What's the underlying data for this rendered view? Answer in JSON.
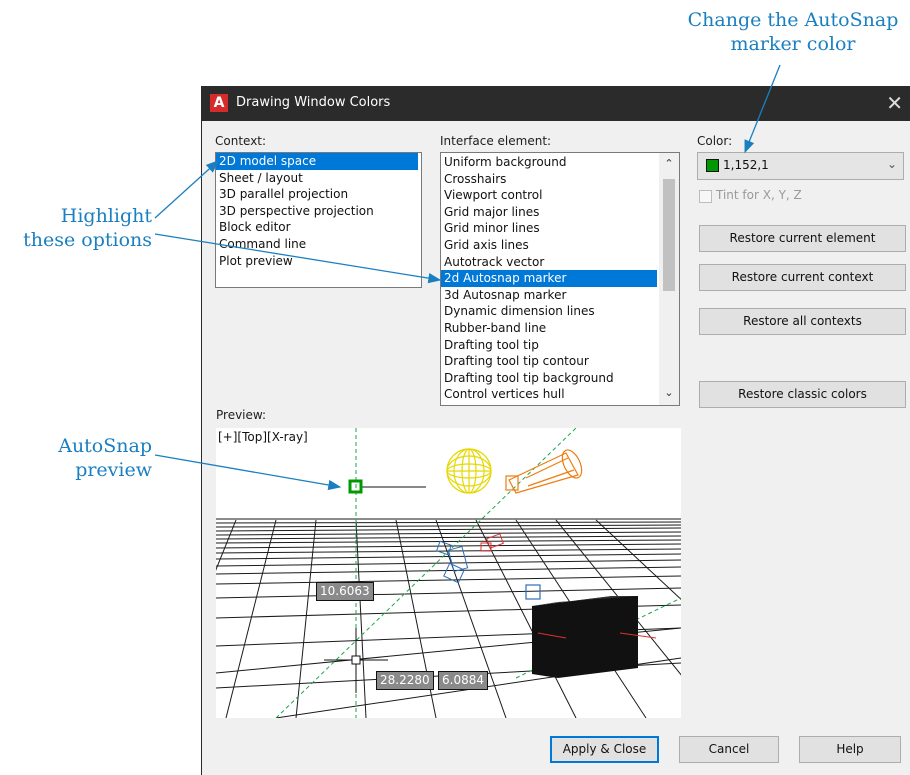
{
  "callouts": {
    "autosnap_color": [
      "Change the AutoSnap",
      "marker color"
    ],
    "highlight": [
      "Highlight",
      "these options"
    ],
    "preview": [
      "AutoSnap",
      "preview"
    ]
  },
  "dialog": {
    "title": "Drawing Window Colors",
    "app_icon": "A",
    "close_icon": "close-icon",
    "context_label": "Context:",
    "context_items": [
      "2D model space",
      "Sheet / layout",
      "3D parallel projection",
      "3D perspective projection",
      "Block editor",
      "Command line",
      "Plot preview"
    ],
    "context_selected": 0,
    "element_label": "Interface element:",
    "element_items": [
      "Uniform background",
      "Crosshairs",
      "Viewport control",
      "Grid major lines",
      "Grid minor lines",
      "Grid axis lines",
      "Autotrack vector",
      "2d Autosnap marker",
      "3d Autosnap marker",
      "Dynamic dimension lines",
      "Rubber-band line",
      "Drafting tool tip",
      "Drafting tool tip contour",
      "Drafting tool tip background",
      "Control vertices hull"
    ],
    "element_selected": 7,
    "color_label": "Color:",
    "color_value": "1,152,1",
    "color_swatch": "#019801",
    "tint_label": "Tint for X, Y, Z",
    "restore_element": "Restore current element",
    "restore_context": "Restore current context",
    "restore_all": "Restore all contexts",
    "restore_classic": "Restore classic colors",
    "preview_label": "Preview:",
    "viewport_label": "[+][Top][X-ray]",
    "dim_1": "10.6063",
    "dim_2": "28.2280",
    "dim_3": "6.0884",
    "apply_close": "Apply & Close",
    "cancel": "Cancel",
    "help": "Help"
  },
  "colors": {
    "callout_blue": "#1a7fc1",
    "selection_blue": "#0078d7",
    "titlebar": "#2b2b2b"
  }
}
